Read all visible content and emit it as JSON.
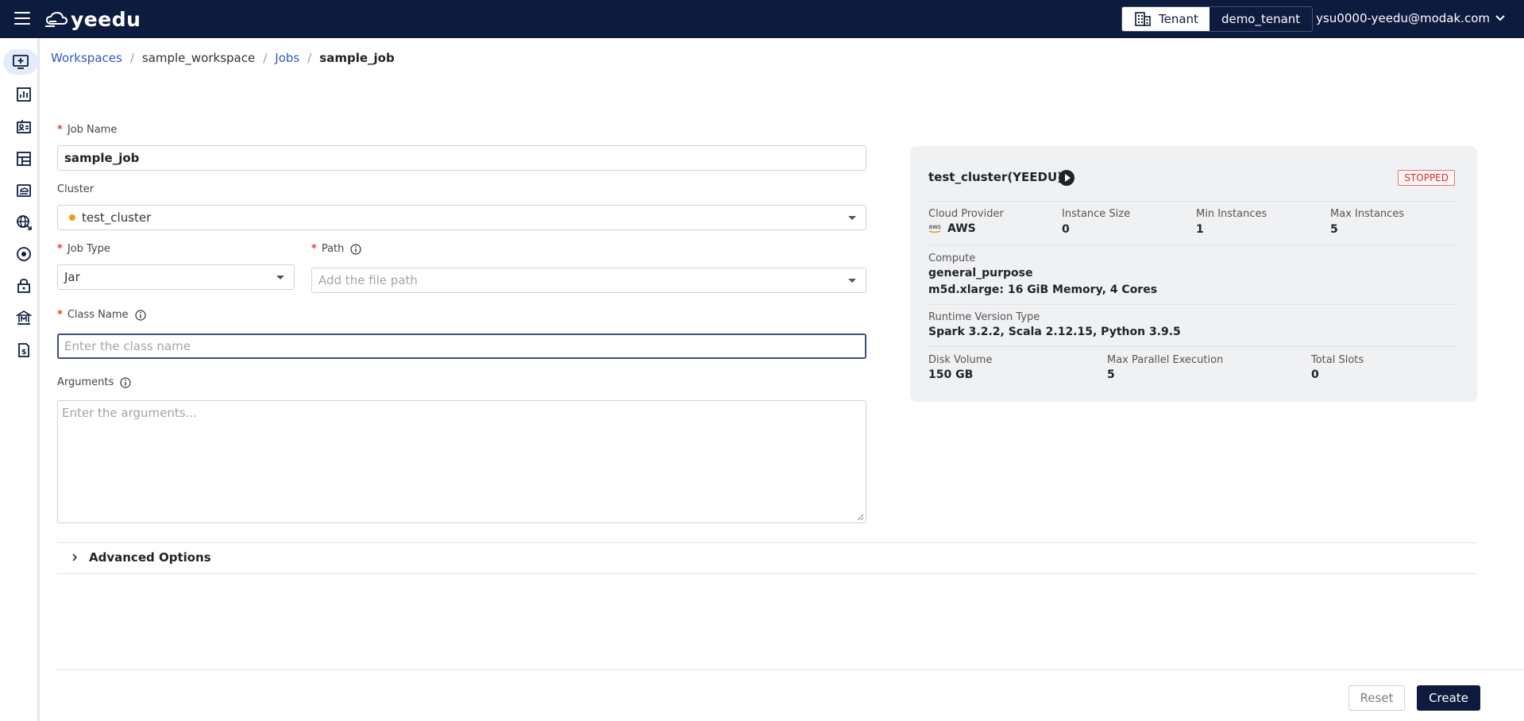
{
  "header": {
    "logo_text": "yeedu",
    "tenant_label": "Tenant",
    "tenant_name": "demo_tenant",
    "user_email": "ysu0000-yeedu@modak.com"
  },
  "sidebar": {
    "items": [
      {
        "icon": "monitor-plus-icon",
        "active": true
      },
      {
        "icon": "bar-chart-icon"
      },
      {
        "icon": "id-card-icon"
      },
      {
        "icon": "layout-grid-icon"
      },
      {
        "icon": "cloud-drive-icon"
      },
      {
        "icon": "globe-icon"
      },
      {
        "icon": "target-icon"
      },
      {
        "icon": "lock-icon"
      },
      {
        "icon": "bank-icon"
      },
      {
        "icon": "invoice-icon"
      }
    ]
  },
  "breadcrumb": {
    "workspaces": "Workspaces",
    "workspace": "sample_workspace",
    "jobs": "Jobs",
    "current": "sample_job"
  },
  "form": {
    "job_name_label": "Job Name",
    "job_name_value": "sample_job",
    "cluster_label": "Cluster",
    "cluster_value": "test_cluster",
    "job_type_label": "Job Type",
    "job_type_value": "Jar",
    "path_label": "Path",
    "path_placeholder": "Add the file path",
    "class_name_label": "Class Name",
    "class_name_placeholder": "Enter the class name",
    "arguments_label": "Arguments",
    "arguments_placeholder": "Enter the arguments..."
  },
  "cluster_card": {
    "title": "test_cluster(YEEDU)",
    "status": "STOPPED",
    "status_color": "#d32f2f",
    "cloud_provider_label": "Cloud Provider",
    "cloud_provider_value": "AWS",
    "instance_size_label": "Instance Size",
    "instance_size_value": "0",
    "min_instances_label": "Min Instances",
    "min_instances_value": "1",
    "max_instances_label": "Max Instances",
    "max_instances_value": "5",
    "compute_label": "Compute",
    "compute_line1": "general_purpose",
    "compute_line2": "m5d.xlarge:  16 GiB Memory,  4 Cores",
    "runtime_label": "Runtime Version Type",
    "runtime_value": "Spark 3.2.2, Scala 2.12.15, Python 3.9.5",
    "disk_label": "Disk Volume",
    "disk_value": "150 GB",
    "max_parallel_label": "Max Parallel Execution",
    "max_parallel_value": "5",
    "total_slots_label": "Total Slots",
    "total_slots_value": "0"
  },
  "advanced": {
    "label": "Advanced Options"
  },
  "footer": {
    "reset_label": "Reset",
    "create_label": "Create"
  }
}
